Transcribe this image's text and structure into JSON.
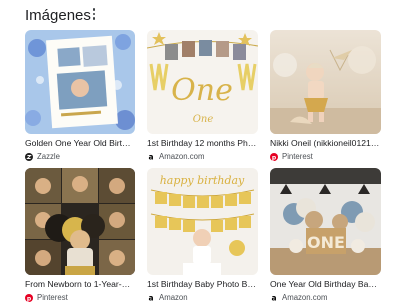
{
  "section": {
    "title": "Imágenes",
    "more_icon": "more-vert-icon"
  },
  "cards": [
    {
      "caption": "Golden One Year Old Birthda...",
      "source": "Zazzle",
      "favicon": "zazzle-icon",
      "color": "#222222"
    },
    {
      "caption": "1st Birthday 12 months Photo ...",
      "source": "Amazon.com",
      "favicon": "amazon-icon",
      "color": "#000000"
    },
    {
      "caption": "Nikki Oneil (nikkioneil0121) - P...",
      "source": "Pinterest",
      "favicon": "pinterest-icon",
      "color": "#e60023"
    },
    {
      "caption": "From Newborn to 1-Year-Old....",
      "source": "Pinterest",
      "favicon": "pinterest-icon",
      "color": "#e60023"
    },
    {
      "caption": "1st Birthday Baby Photo Bann...",
      "source": "Amazon",
      "favicon": "amazon-icon",
      "color": "#000000"
    },
    {
      "caption": "One Year Old Birthday Backd...",
      "source": "Amazon.com",
      "favicon": "amazon-icon",
      "color": "#000000"
    }
  ],
  "image_text": {
    "card2_one": "One",
    "card2_one_small": "One",
    "card5_happy": "happy birthday",
    "card6_one": "ONE"
  }
}
